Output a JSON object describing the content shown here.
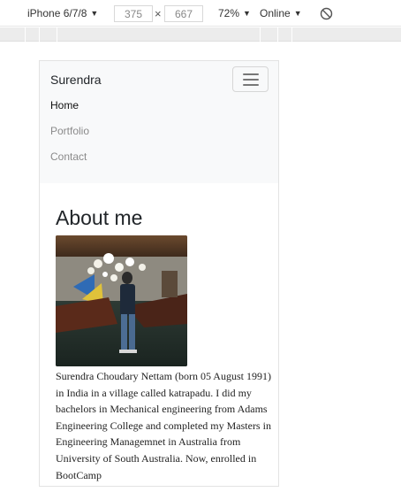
{
  "devtools": {
    "device": "iPhone 6/7/8",
    "width": "375",
    "times": "×",
    "height": "667",
    "zoom": "72%",
    "network": "Online"
  },
  "icons": {
    "rotate": "rotate-icon",
    "dropdown": "caret-down-icon",
    "menu": "hamburger-icon"
  },
  "navbar": {
    "brand": "Surendra",
    "links": [
      "Home",
      "Portfolio",
      "Contact"
    ]
  },
  "main": {
    "heading": "About me",
    "bio": "Surendra Choudary Nettam (born 05 August 1991) in India in a village called katrapadu. I did my bachelors in Mechanical engineering from Adams Engineering College and completed my Masters in Engineering Managemnet in Australia from University of South Australia. Now, enrolled in BootCamp"
  },
  "colors": {
    "navbar_bg": "#f8f9fa",
    "active_link": "#111111",
    "inactive_link": "#8a8a8a",
    "text": "#212529"
  }
}
